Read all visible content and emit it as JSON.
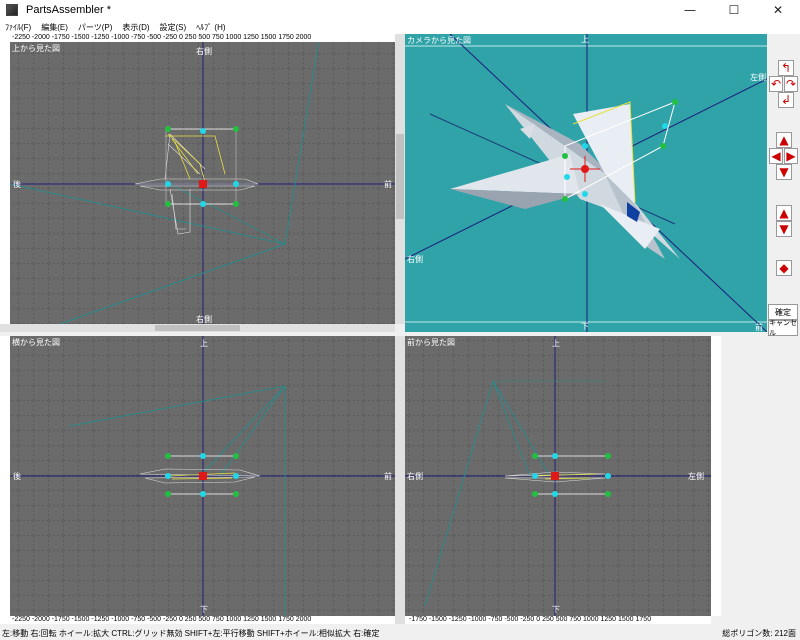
{
  "window": {
    "title": "PartsAssembler *",
    "minimize": "—",
    "maximize": "☐",
    "close": "✕"
  },
  "menu": [
    {
      "label": "ﾌｧｲﾙ(F)"
    },
    {
      "label": "編集(E)"
    },
    {
      "label": "パーツ(P)"
    },
    {
      "label": "表示(D)"
    },
    {
      "label": "設定(S)"
    },
    {
      "label": "ﾍﾙﾌﾟ (H)"
    }
  ],
  "views": {
    "top": {
      "label": "上から見た図",
      "top_axis": "右側",
      "bottom_axis": "右側",
      "left_axis": "後",
      "right_axis": "前"
    },
    "camera": {
      "label": "カメラから見た図",
      "top_axis": "上",
      "bottom_axis": "下",
      "right_axis": "左側",
      "left_axis": "右側",
      "front_axis": "前"
    },
    "side": {
      "label": "横から見た図",
      "top_axis": "上",
      "bottom_axis": "下",
      "left_axis": "後",
      "right_axis": "前"
    },
    "front": {
      "label": "前から見た図",
      "top_axis": "上",
      "bottom_axis": "下",
      "left_axis": "右側",
      "right_axis": "左側"
    }
  },
  "rulers": {
    "top_h": "-2250 -2000 -1750 -1500 -1250 -1000 -750 -500 -250 0   250  500  750  1000 1250 1500 1750 2000",
    "bottom_left_h": "-2250 -2000 -1750 -1500 -1250 -1000 -750 -500 -250 0   250  500  750  1000 1250 1500 1750 2000",
    "bottom_right_h": "-1750 -1500 -1250 -1000 -750 -500 -250 0   250  500  750  1000 1250 1500 1750"
  },
  "buttons": {
    "confirm": "確定",
    "cancel": "キャンセル"
  },
  "status": {
    "left": "左:移動  右:回転  ホイール:拡大  CTRL:グリッド無効  SHIFT+左:平行移動  SHIFT+ホイール:相似拡大  右:確定",
    "right": "総ポリゴン数:  212面"
  },
  "colors": {
    "viewport_bg": "#6b6b6b",
    "camera_bg": "#2fa3a8",
    "grid": "#3a3a3a",
    "axis": "#1c1c7a",
    "handle_green": "#22c040",
    "handle_cyan": "#22d8e8",
    "handle_red": "#e01818"
  }
}
